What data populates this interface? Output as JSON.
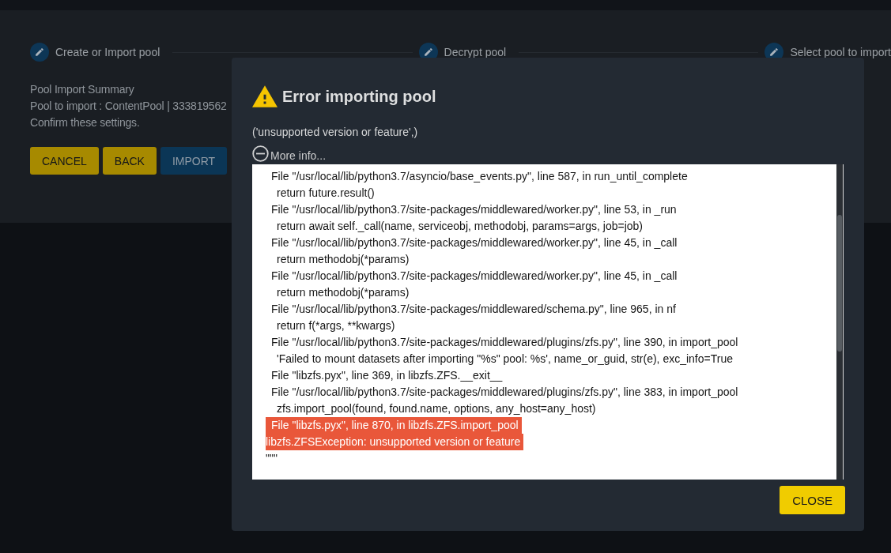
{
  "stepper": {
    "steps": [
      {
        "label": "Create or Import pool"
      },
      {
        "label": "Decrypt pool"
      },
      {
        "label": "Select pool to import"
      }
    ]
  },
  "summary": {
    "title": "Pool Import Summary",
    "lines": [
      "Pool to import : ContentPool | 333819562",
      "Confirm these settings."
    ]
  },
  "actions": [
    {
      "label": "CANCEL",
      "kind": "secondary"
    },
    {
      "label": "BACK",
      "kind": "secondary"
    },
    {
      "label": "IMPORT",
      "kind": "primary"
    }
  ],
  "dialog": {
    "title": "Error importing pool",
    "message": "('unsupported version or feature',)",
    "details_toggle": {
      "label": "More info...",
      "expanded": true
    },
    "traceback": [
      {
        "kind": "frame",
        "text": "File \"/usr/local/lib/python3.7/asyncio/base_events.py\", line 587, in run_until_complete",
        "selected": false
      },
      {
        "kind": "code",
        "text": "return future.result()",
        "selected": false
      },
      {
        "kind": "frame",
        "text": "File \"/usr/local/lib/python3.7/site-packages/middlewared/worker.py\", line 53, in _run",
        "selected": false
      },
      {
        "kind": "code",
        "text": "return await self._call(name, serviceobj, methodobj, params=args, job=job)",
        "selected": false
      },
      {
        "kind": "frame",
        "text": "File \"/usr/local/lib/python3.7/site-packages/middlewared/worker.py\", line 45, in _call",
        "selected": false
      },
      {
        "kind": "code",
        "text": "return methodobj(*params)",
        "selected": false
      },
      {
        "kind": "frame",
        "text": "File \"/usr/local/lib/python3.7/site-packages/middlewared/worker.py\", line 45, in _call",
        "selected": false
      },
      {
        "kind": "code",
        "text": "return methodobj(*params)",
        "selected": false
      },
      {
        "kind": "frame",
        "text": "File \"/usr/local/lib/python3.7/site-packages/middlewared/schema.py\", line 965, in nf",
        "selected": false
      },
      {
        "kind": "code",
        "text": "return f(*args, **kwargs)",
        "selected": false
      },
      {
        "kind": "frame",
        "text": "File \"/usr/local/lib/python3.7/site-packages/middlewared/plugins/zfs.py\", line 390, in import_pool",
        "selected": false
      },
      {
        "kind": "code",
        "text": "'Failed to mount datasets after importing \"%s\" pool: %s', name_or_guid, str(e), exc_info=True",
        "selected": false
      },
      {
        "kind": "frame",
        "text": "File \"libzfs.pyx\", line 369, in libzfs.ZFS.__exit__",
        "selected": false
      },
      {
        "kind": "frame",
        "text": "File \"/usr/local/lib/python3.7/site-packages/middlewared/plugins/zfs.py\", line 383, in import_pool",
        "selected": false
      },
      {
        "kind": "code",
        "text": "zfs.import_pool(found, found.name, options, any_host=any_host)",
        "selected": false
      },
      {
        "kind": "frame",
        "text": "File \"libzfs.pyx\", line 870, in libzfs.ZFS.import_pool",
        "selected": true
      },
      {
        "kind": "exception",
        "text": "libzfs.ZFSException: unsupported version or feature",
        "selected": true
      },
      {
        "kind": "exception",
        "text": "\"\"\"",
        "selected": false
      }
    ],
    "buttons": [
      {
        "label": "CLOSE"
      }
    ]
  }
}
